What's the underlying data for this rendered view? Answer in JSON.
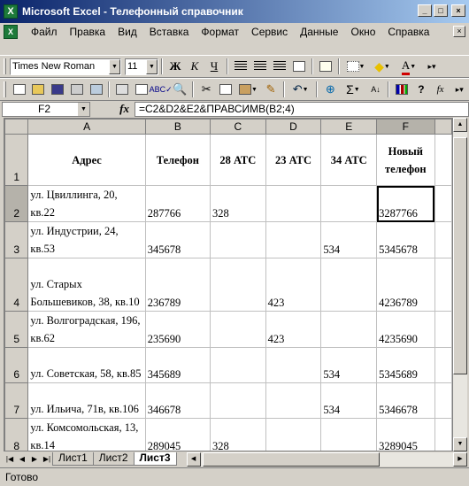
{
  "window": {
    "title": "Microsoft Excel - Телефонный справочник",
    "app_icon_letter": "X",
    "minimize": "_",
    "maximize": "□",
    "close": "×"
  },
  "menu": [
    "Файл",
    "Правка",
    "Вид",
    "Вставка",
    "Формат",
    "Сервис",
    "Данные",
    "Окно",
    "Справка"
  ],
  "toolbar1": {
    "font_name": "Times New Roman",
    "font_size": "11",
    "bold": "Ж",
    "italic": "К",
    "underline": "Ч",
    "font_color": "A"
  },
  "toolbar2": {
    "sum": "Σ",
    "fx": "fx"
  },
  "formula_bar": {
    "name_box": "F2",
    "fx_label": "fx",
    "formula": "=C2&D2&E2&ПРАВСИМВ(B2;4)"
  },
  "sheet": {
    "columns": [
      "A",
      "B",
      "C",
      "D",
      "E",
      "F"
    ],
    "selected_column": "F",
    "selected_row": "2",
    "headers": {
      "row_num": "1",
      "address": "Адрес",
      "phone": "Телефон",
      "ats28": "28 АТС",
      "ats23": "23 АТС",
      "ats34": "34 АТС",
      "new_phone": "Новый телефон"
    },
    "rows": [
      {
        "num": "2",
        "address": "ул. Цвиллинга, 20, кв.22",
        "phone": "287766",
        "ats28": "328",
        "ats23": "",
        "ats34": "",
        "new_phone": "3287766"
      },
      {
        "num": "3",
        "address": "ул. Индустрии, 24, кв.53",
        "phone": "345678",
        "ats28": "",
        "ats23": "",
        "ats34": "534",
        "new_phone": "5345678"
      },
      {
        "num": "4",
        "address": "ул. Старых Большевиков, 38, кв.10",
        "phone": "236789",
        "ats28": "",
        "ats23": "423",
        "ats34": "",
        "new_phone": "4236789"
      },
      {
        "num": "5",
        "address": "ул. Волгоградская, 196, кв.62",
        "phone": "235690",
        "ats28": "",
        "ats23": "423",
        "ats34": "",
        "new_phone": "4235690"
      },
      {
        "num": "6",
        "address": "ул. Советская, 58, кв.85",
        "phone": "345689",
        "ats28": "",
        "ats23": "",
        "ats34": "534",
        "new_phone": "5345689"
      },
      {
        "num": "7",
        "address": "ул. Ильича, 71в, кв.106",
        "phone": "346678",
        "ats28": "",
        "ats23": "",
        "ats34": "534",
        "new_phone": "5346678"
      },
      {
        "num": "8",
        "address": "ул. Комсомольская, 13, кв.14",
        "phone": "289045",
        "ats28": "328",
        "ats23": "",
        "ats34": "",
        "new_phone": "3289045"
      }
    ]
  },
  "tabs": [
    "Лист1",
    "Лист2",
    "Лист3"
  ],
  "active_tab": "Лист3",
  "status": "Готово"
}
